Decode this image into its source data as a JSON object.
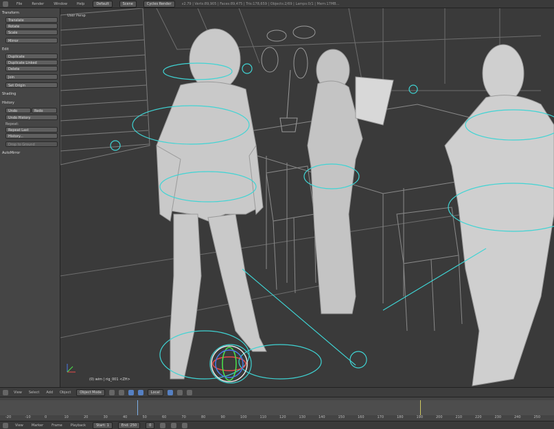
{
  "topbar": {
    "menus": [
      "File",
      "Render",
      "Window",
      "Help"
    ],
    "layout": "Default",
    "scene": "Scene",
    "render_engine": "Cycles Render",
    "stats": "v2.79 | Verts:89,905 | Faces:89,475 | Tris:178,659 | Objects:2/69 | Lamps:0/1 | Mem:17MB..."
  },
  "toolshelf": {
    "transform_header": "Transform",
    "transform_buttons": [
      "Translate",
      "Rotate",
      "Scale",
      "Mirror"
    ],
    "edit_header": "Edit",
    "edit_buttons": [
      "Duplicate",
      "Duplicate Linked",
      "Delete",
      "Join"
    ],
    "set_origin": "Set Origin",
    "shading_header": "Shading",
    "history_header": "History",
    "undo_label": "Undo",
    "redo_label": "Redo",
    "undo_history": "Undo History",
    "repeat_label": "Repeat:",
    "repeat_last": "Repeat Last",
    "history_btn": "History...",
    "snap_ground": "Drop to Ground",
    "auto_mirror": "AutoMirror"
  },
  "viewport": {
    "view_label": "User Persp",
    "info": "(0) wim | rig_001 <ZH>"
  },
  "viewbar": {
    "items": [
      "View",
      "Select",
      "Add",
      "Object"
    ],
    "mode": "Object Mode",
    "pivot": "Local"
  },
  "timeline": {
    "ticks": [
      "-20",
      "-10",
      "0",
      "10",
      "20",
      "30",
      "40",
      "50",
      "60",
      "70",
      "80",
      "90",
      "100",
      "110",
      "120",
      "130",
      "140",
      "150",
      "160",
      "170",
      "180",
      "190",
      "200",
      "210",
      "220",
      "230",
      "240",
      "250"
    ]
  },
  "bottombar": {
    "items": [
      "View",
      "Marker",
      "Frame",
      "Playback"
    ],
    "start_label": "Start:",
    "start_value": "1",
    "end_label": "End:",
    "end_value": "250",
    "current": "0"
  }
}
